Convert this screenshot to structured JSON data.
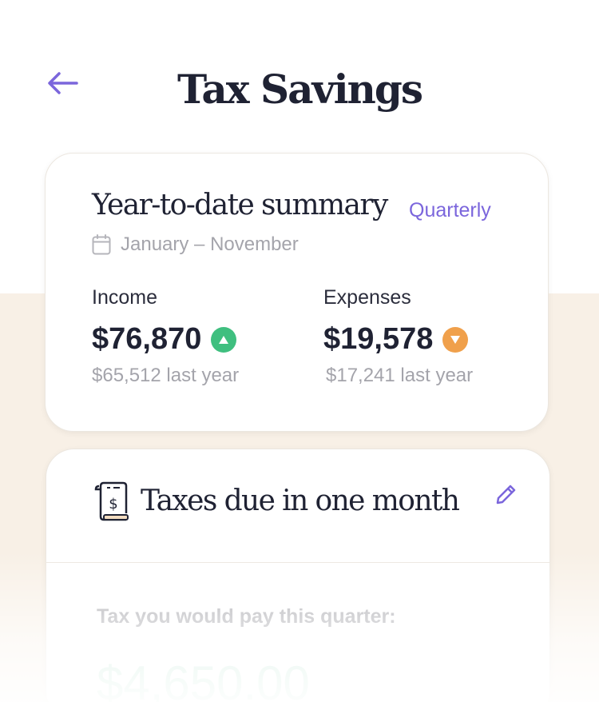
{
  "header": {
    "title": "Tax Savings",
    "back_icon": "arrow-left-icon",
    "accent_color": "#7b66dc"
  },
  "summary": {
    "title": "Year-to-date summary",
    "period_toggle": "Quarterly",
    "date_range": "January – November",
    "income": {
      "label": "Income",
      "value": "$76,870",
      "trend": "up",
      "trend_color": "#3fbf7f",
      "last_year": "$65,512 last year"
    },
    "expenses": {
      "label": "Expenses",
      "value": "$19,578",
      "trend": "down",
      "trend_color": "#f0a04b",
      "last_year": "$17,241 last year"
    }
  },
  "taxes": {
    "title": "Taxes due in one month",
    "icon": "receipt-dollar-icon",
    "edit_icon": "pencil-icon",
    "pay_label": "Tax you would pay this quarter:",
    "amount": "$4,650.00"
  }
}
